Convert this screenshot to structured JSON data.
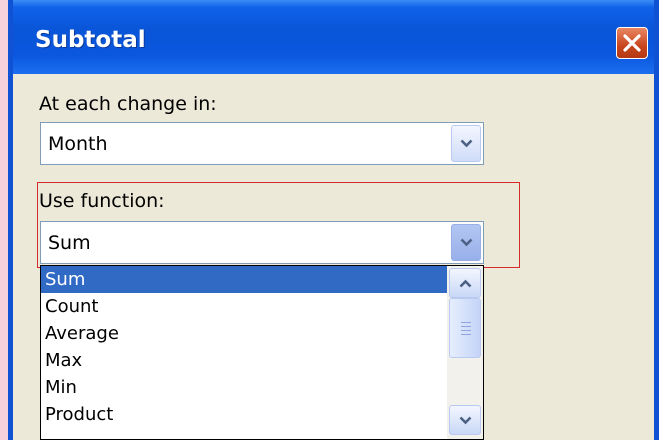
{
  "dialog": {
    "title": "Subtotal",
    "close_icon": "close-x-icon"
  },
  "change_in": {
    "label": "At each change in:",
    "value": "Month",
    "dropdown_icon": "chevron-down-icon"
  },
  "use_function": {
    "label": "Use function:",
    "value": "Sum",
    "dropdown_icon": "chevron-down-icon",
    "options": [
      "Sum",
      "Count",
      "Average",
      "Max",
      "Min",
      "Product"
    ],
    "selected_option": "Sum"
  },
  "colors": {
    "title_bar": "#0a55d8",
    "close_button": "#c8461e",
    "selection": "#316ac5",
    "highlight_border": "#d42a2a",
    "dialog_background": "#ece9d8"
  }
}
